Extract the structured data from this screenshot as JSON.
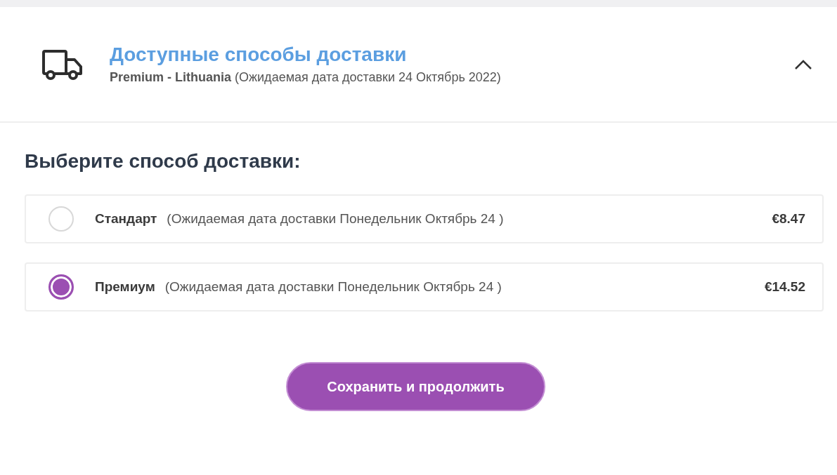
{
  "section": {
    "title": "Доступные способы доставки",
    "summary": "**Premium - Lithuania** (Ожидаемая дата доставки 24 Октябрь 2022)",
    "expanded": true
  },
  "prompt": "Выберите способ доставки:",
  "options": [
    {
      "name": "Стандарт",
      "note": "(Ожидаемая дата доставки Понедельник Октябрь 24 )",
      "price": "€8.47",
      "selected": false
    },
    {
      "name": "Премиум",
      "note": "(Ожидаемая дата доставки Понедельник Октябрь 24 )",
      "price": "€14.52",
      "selected": true
    }
  ],
  "button": "Сохранить и продолжить"
}
